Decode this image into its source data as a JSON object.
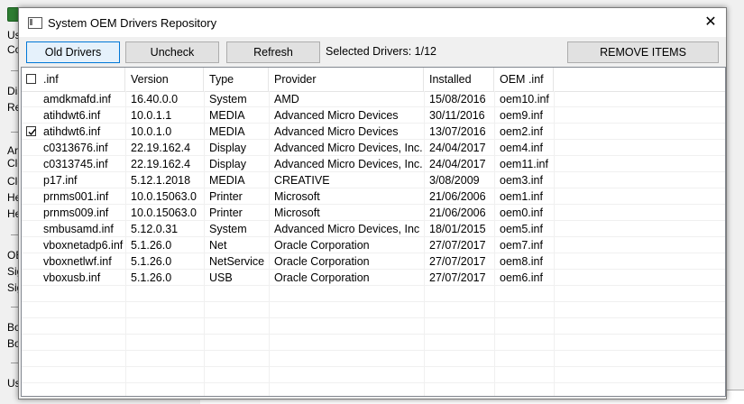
{
  "background_app": {
    "rows": [
      "Us",
      "Co",
      "Dis",
      "Re",
      "Ar",
      "Cle",
      "Cle",
      "He",
      "He",
      "OE",
      "Sig",
      "Sig",
      "Bo",
      "Bo",
      "Us"
    ]
  },
  "dialog": {
    "title": "System OEM Drivers Repository",
    "close_label": "✕"
  },
  "toolbar": {
    "old_drivers": "Old Drivers",
    "uncheck": "Uncheck",
    "refresh": "Refresh",
    "selected_text": "Selected Drivers: 1/12",
    "remove_items": "REMOVE ITEMS"
  },
  "table": {
    "headers": [
      ".inf",
      "Version",
      "Type",
      "Provider",
      "Installed",
      "OEM .inf"
    ],
    "header_checked": false,
    "rows": [
      {
        "inf": "amdkmafd.inf",
        "version": "16.40.0.0",
        "type": "System",
        "provider": "AMD",
        "installed": "15/08/2016",
        "oem": "oem10.inf",
        "checked": false
      },
      {
        "inf": "atihdwt6.inf",
        "version": "10.0.1.1",
        "type": "MEDIA",
        "provider": "Advanced Micro Devices",
        "installed": "30/11/2016",
        "oem": "oem9.inf",
        "checked": false
      },
      {
        "inf": "atihdwt6.inf",
        "version": "10.0.1.0",
        "type": "MEDIA",
        "provider": "Advanced Micro Devices",
        "installed": "13/07/2016",
        "oem": "oem2.inf",
        "checked": true
      },
      {
        "inf": "c0313676.inf",
        "version": "22.19.162.4",
        "type": "Display",
        "provider": "Advanced Micro Devices, Inc.",
        "installed": "24/04/2017",
        "oem": "oem4.inf",
        "checked": false
      },
      {
        "inf": "c0313745.inf",
        "version": "22.19.162.4",
        "type": "Display",
        "provider": "Advanced Micro Devices, Inc.",
        "installed": "24/04/2017",
        "oem": "oem11.inf",
        "checked": false
      },
      {
        "inf": "p17.inf",
        "version": "5.12.1.2018",
        "type": "MEDIA",
        "provider": "CREATIVE",
        "installed": "3/08/2009",
        "oem": "oem3.inf",
        "checked": false
      },
      {
        "inf": "prnms001.inf",
        "version": "10.0.15063.0",
        "type": "Printer",
        "provider": "Microsoft",
        "installed": "21/06/2006",
        "oem": "oem1.inf",
        "checked": false
      },
      {
        "inf": "prnms009.inf",
        "version": "10.0.15063.0",
        "type": "Printer",
        "provider": "Microsoft",
        "installed": "21/06/2006",
        "oem": "oem0.inf",
        "checked": false
      },
      {
        "inf": "smbusamd.inf",
        "version": "5.12.0.31",
        "type": "System",
        "provider": "Advanced Micro Devices, Inc",
        "installed": "18/01/2015",
        "oem": "oem5.inf",
        "checked": false
      },
      {
        "inf": "vboxnetadp6.inf",
        "version": "5.1.26.0",
        "type": "Net",
        "provider": "Oracle Corporation",
        "installed": "27/07/2017",
        "oem": "oem7.inf",
        "checked": false
      },
      {
        "inf": "vboxnetlwf.inf",
        "version": "5.1.26.0",
        "type": "NetService",
        "provider": "Oracle Corporation",
        "installed": "27/07/2017",
        "oem": "oem8.inf",
        "checked": false
      },
      {
        "inf": "vboxusb.inf",
        "version": "5.1.26.0",
        "type": "USB",
        "provider": "Oracle Corporation",
        "installed": "27/07/2017",
        "oem": "oem6.inf",
        "checked": false
      }
    ]
  }
}
